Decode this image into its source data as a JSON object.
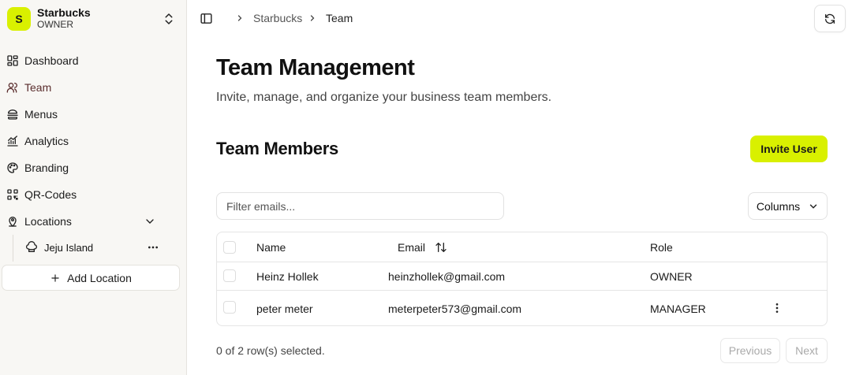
{
  "org": {
    "initial": "S",
    "name": "Starbucks",
    "role": "OWNER"
  },
  "sidebar": {
    "items": [
      {
        "label": "Dashboard",
        "icon": "dashboard-icon"
      },
      {
        "label": "Team",
        "icon": "users-icon",
        "active": true
      },
      {
        "label": "Menus",
        "icon": "menu-burger-icon"
      },
      {
        "label": "Analytics",
        "icon": "chart-icon"
      },
      {
        "label": "Branding",
        "icon": "palette-icon"
      },
      {
        "label": "QR-Codes",
        "icon": "qr-code-icon"
      },
      {
        "label": "Locations",
        "icon": "location-pin-icon"
      }
    ],
    "sub_items": [
      {
        "label": "Jeju Island",
        "icon": "chef-hat-icon"
      }
    ],
    "add_location_label": "Add Location"
  },
  "breadcrumb": {
    "items": [
      "Starbucks",
      "Team"
    ]
  },
  "page": {
    "title": "Team Management",
    "subtitle": "Invite, manage, and organize your business team members."
  },
  "section": {
    "title": "Team Members",
    "invite_label": "Invite User"
  },
  "filter": {
    "placeholder": "Filter emails...",
    "value": ""
  },
  "columns_label": "Columns",
  "table": {
    "headers": {
      "name": "Name",
      "email": "Email",
      "role": "Role"
    },
    "rows": [
      {
        "name": "Heinz Hollek",
        "email": "heinzhollek@gmail.com",
        "role": "OWNER"
      },
      {
        "name": "peter meter",
        "email": "meterpeter573@gmail.com",
        "role": "MANAGER"
      }
    ]
  },
  "footer": {
    "selected_text": "0 of 2 row(s) selected.",
    "previous_label": "Previous",
    "next_label": "Next"
  },
  "colors": {
    "accent": "#d9f000",
    "sidebar_bg": "#f8f7f4"
  }
}
